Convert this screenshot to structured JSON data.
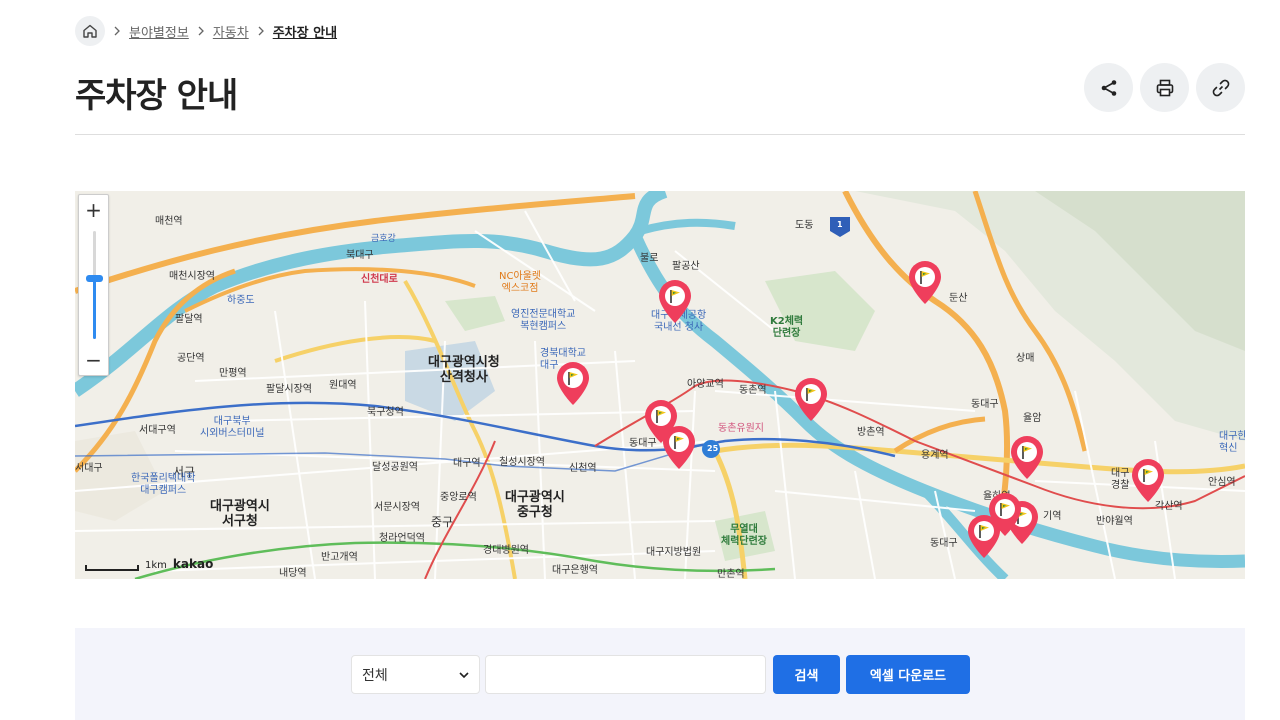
{
  "breadcrumb": {
    "home_icon": "house-icon",
    "items": [
      "분야별정보",
      "자동차",
      "주차장 안내"
    ]
  },
  "page": {
    "title": "주차장 안내"
  },
  "actions": {
    "share_icon": "share-icon",
    "print_icon": "printer-icon",
    "link_icon": "link-icon"
  },
  "map": {
    "zoom_in": "+",
    "zoom_out": "−",
    "scale_label": "1km",
    "provider": "kakao",
    "labels": {
      "maecheon": "매천역",
      "maecheon_market": "매천시장역",
      "hajungdo": "하중도",
      "paldal": "팔달역",
      "gongdan": "공단역",
      "manpyeong": "만평역",
      "paldal_market": "팔달시장역",
      "wondae": "원대역",
      "bukgucheong": "북구청역",
      "bukdaegu": "북대구",
      "geumho": "금호강",
      "sincheon": "신천대로",
      "nc_line1": "NC아울렛",
      "nc_line2": "엑스코점",
      "yeungjin_line1": "영진전문대학교",
      "yeungjin_line2": "복현캠퍼스",
      "knu": "경북대학교",
      "knu2": "대구",
      "cityhall_line1": "대구광역시청",
      "cityhall_line2": "산격청사",
      "bullo": "불로",
      "palgongsan": "팔공산",
      "airport_line1": "대구국제공항",
      "airport_line2": "국내선 청사",
      "k2_line1": "K2체력",
      "k2_line2": "단련장",
      "dodong": "도동",
      "dunsan": "둔산",
      "sangmae": "상매",
      "dongdaegu": "동대구",
      "yuleam": "율암",
      "ayanggyo": "아양교역",
      "dongchon": "동촌역",
      "dongchon_park": "동촌유원지",
      "bangchon": "방촌역",
      "yonggye": "용계역",
      "yulha": "율하역",
      "ansim": "안심역",
      "gaksan": "각산역",
      "banyawol": "반야월역",
      "dongdaegu_station": "동대구",
      "sincheon_station": "신천역",
      "chilseong": "칠성시장역",
      "daegu_station": "대구역",
      "seodaegu": "서대구역",
      "seodaegu2": "서대구",
      "bukbu_line1": "대구북부",
      "bukbu_line2": "시외버스터미널",
      "seogu": "서구",
      "polytech_line1": "한국폴리텍대학",
      "polytech_line2": "대구캠퍼스",
      "seogucheong_line1": "대구광역시",
      "seogucheong_line2": "서구청",
      "dalseong": "달성공원역",
      "seomun": "서문시장역",
      "jungang": "중앙로역",
      "junggucheong_line1": "대구광역시",
      "junggucheong_line2": "중구청",
      "junggu": "중구",
      "cheongna": "청라언덕역",
      "bangogae": "반고개역",
      "naedang": "내당역",
      "gyeongdae": "경대병원역",
      "daegu_bank": "대구은행역",
      "court": "대구지방법원",
      "mangchon": "만촌역",
      "muyeol_line1": "무열대",
      "muyeol_line2": "체력단련장",
      "dongdaegu_ic": "동대구",
      "right_edge_line1": "대구한",
      "right_edge_line2": "혁신",
      "gyeongchal": "경찰",
      "gyeongchal2": "대구",
      "gi_station": "기역",
      "road_25": "25",
      "road_1": "1"
    },
    "marker_icon": "parking-flag-marker-icon",
    "marker_count": 12
  },
  "search": {
    "category_selected": "전체",
    "category_icon": "chevron-down-icon",
    "keyword_value": "",
    "keyword_placeholder": "",
    "search_label": "검색",
    "excel_label": "엑셀 다운로드"
  },
  "colors": {
    "accent": "#1f6fe5",
    "marker": "#ef3e5c",
    "marker_flag": "#f2c61b",
    "river": "#7cc8db",
    "panel": "#f3f4fb"
  }
}
